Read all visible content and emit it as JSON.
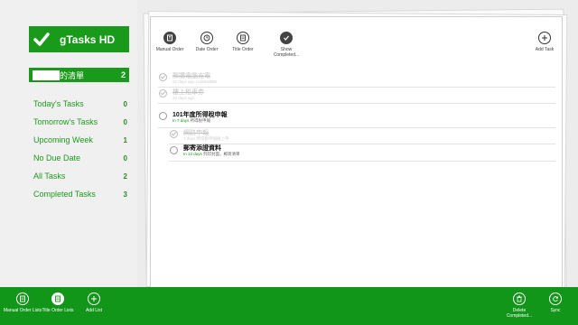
{
  "app": {
    "title": "gTasks HD"
  },
  "sidebar": {
    "current_list": {
      "name": "的清單",
      "count": "2"
    },
    "items": [
      {
        "label": "Today's Tasks",
        "count": "0"
      },
      {
        "label": "Tomorrow's Tasks",
        "count": "0"
      },
      {
        "label": "Upcoming Week",
        "count": "1"
      },
      {
        "label": "No Due Date",
        "count": "0"
      },
      {
        "label": "All Tasks",
        "count": "2"
      },
      {
        "label": "Completed Tasks",
        "count": "3"
      }
    ]
  },
  "toolbar": {
    "manual_order": "Manual Order",
    "date_order": "Date Order",
    "title_order": "Title Order",
    "show_completed": "Show Completed...",
    "add_task": "Add Task"
  },
  "tasks": [
    {
      "title": "郵購電腦充電",
      "sub": "32 days ago  co20b48BB",
      "done": true
    },
    {
      "title": "樓上租車券",
      "sub": "33 days ago",
      "done": true
    },
    {
      "title": "101年度所得稅申報",
      "due": "In 7 days",
      "sub": "所得稅申報",
      "done": false
    },
    {
      "title": "網路申報",
      "due": "",
      "sub": "7 days  所得稅申報線上申",
      "done": true
    },
    {
      "title": "郵寄添證資料",
      "due": "In 12 days",
      "sub": "列印封面，郵寄清單",
      "done": false
    }
  ],
  "appbar": {
    "manual_order_lists": "Manual Order Lists",
    "title_order_lists": "Title Order Lists",
    "add_list": "Add List",
    "delete_completed": "Delete Completed...",
    "sync": "Sync"
  },
  "colors": {
    "accent": "#12961a",
    "sidebar_bg": "#f0f0f0"
  }
}
